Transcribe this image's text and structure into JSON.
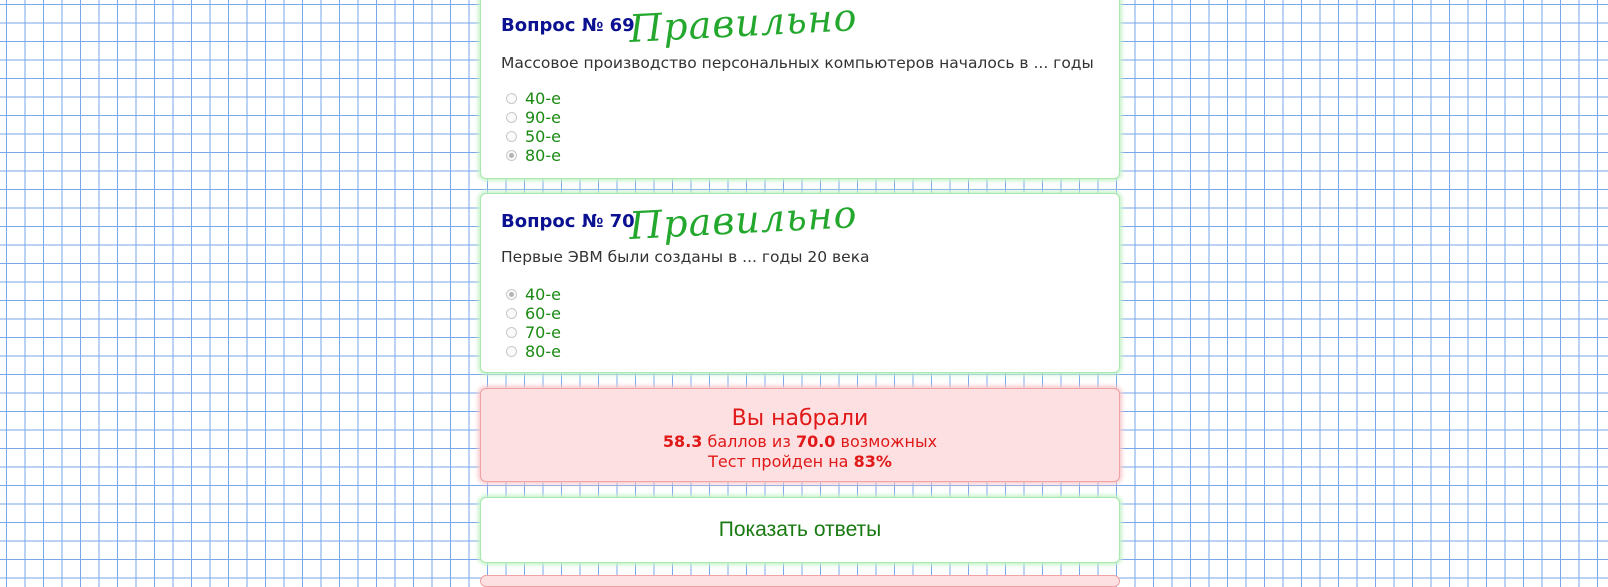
{
  "questions": [
    {
      "title": "Вопрос № 69",
      "text": "Массовое производство персональных компьютеров началось в ... годы",
      "status": "Правильно",
      "options": [
        {
          "label": "40-е",
          "checked": false
        },
        {
          "label": "90-е",
          "checked": false
        },
        {
          "label": "50-е",
          "checked": false
        },
        {
          "label": "80-е",
          "checked": true
        }
      ]
    },
    {
      "title": "Вопрос № 70",
      "text": "Первые ЭВМ были созданы в ... годы 20 века",
      "status": "Правильно",
      "options": [
        {
          "label": "40-е",
          "checked": true
        },
        {
          "label": "60-е",
          "checked": false
        },
        {
          "label": "70-е",
          "checked": false
        },
        {
          "label": "80-е",
          "checked": false
        }
      ]
    }
  ],
  "result": {
    "title": "Вы набрали",
    "score": "58.3",
    "score_text": "баллов из",
    "max": "70.0",
    "max_text": "возможных",
    "passed_text": "Тест пройден на",
    "percent": "83%"
  },
  "show_answers_label": "Показать ответы",
  "colors": {
    "title": "#0b1190",
    "option": "#1a8a12",
    "stamp": "#11a01c",
    "result_text": "#e01818",
    "result_bg": "#fde0e1",
    "grid": "#7aa6ea"
  }
}
